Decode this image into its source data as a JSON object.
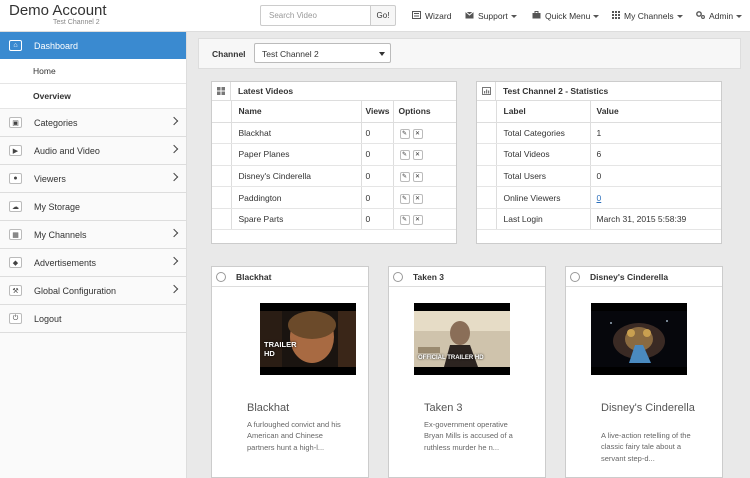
{
  "header": {
    "brand_title": "Demo Account",
    "brand_subtitle": "Test Channel 2",
    "search_placeholder": "Search Video",
    "search_button": "Go!",
    "nav": {
      "wizard": "Wizard",
      "support": "Support",
      "quick_menu": "Quick Menu",
      "my_channels": "My Channels",
      "admin": "Admin"
    }
  },
  "sidebar": {
    "dashboard": "Dashboard",
    "home": "Home",
    "overview": "Overview",
    "categories": "Categories",
    "audio_video": "Audio and Video",
    "viewers": "Viewers",
    "my_storage": "My Storage",
    "my_channels": "My Channels",
    "advertisements": "Advertisements",
    "global_configuration": "Global Configuration",
    "logout": "Logout"
  },
  "filter": {
    "label": "Channel",
    "selected": "Test Channel 2"
  },
  "latest_videos": {
    "title": "Latest Videos",
    "col_name": "Name",
    "col_views": "Views",
    "col_options": "Options",
    "rows": [
      {
        "name": "Blackhat",
        "views": "0"
      },
      {
        "name": "Paper Planes",
        "views": "0"
      },
      {
        "name": "Disney's Cinderella",
        "views": "0"
      },
      {
        "name": "Paddington",
        "views": "0"
      },
      {
        "name": "Spare Parts",
        "views": "0"
      }
    ]
  },
  "statistics": {
    "title": "Test Channel 2 - Statistics",
    "col_label": "Label",
    "col_value": "Value",
    "rows": [
      {
        "label": "Total Categories",
        "value": "1"
      },
      {
        "label": "Total Videos",
        "value": "6"
      },
      {
        "label": "Total Users",
        "value": "0"
      },
      {
        "label": "Online Viewers",
        "value": "0"
      },
      {
        "label": "Last Login",
        "value": "March 31, 2015 5:58:39"
      }
    ]
  },
  "cards": [
    {
      "header": "Blackhat",
      "title": "Blackhat",
      "desc": "A furloughed convict and his American and Chinese partners hunt a high-l...",
      "thumb_badge": "TRAILER HD"
    },
    {
      "header": "Taken 3",
      "title": "Taken 3",
      "desc": "Ex-government operative Bryan Mills is accused of a ruthless murder he n...",
      "thumb_badge": "OFFICIAL TRAILER HD"
    },
    {
      "header": "Disney's Cinderella",
      "title": "Disney's Cinderella",
      "desc": "A live-action retelling of the classic fairy tale about a servant step-d..."
    }
  ],
  "colors": {
    "accent": "#3a8ad0",
    "background": "#e9e9e9",
    "link": "#2a6ebb"
  }
}
